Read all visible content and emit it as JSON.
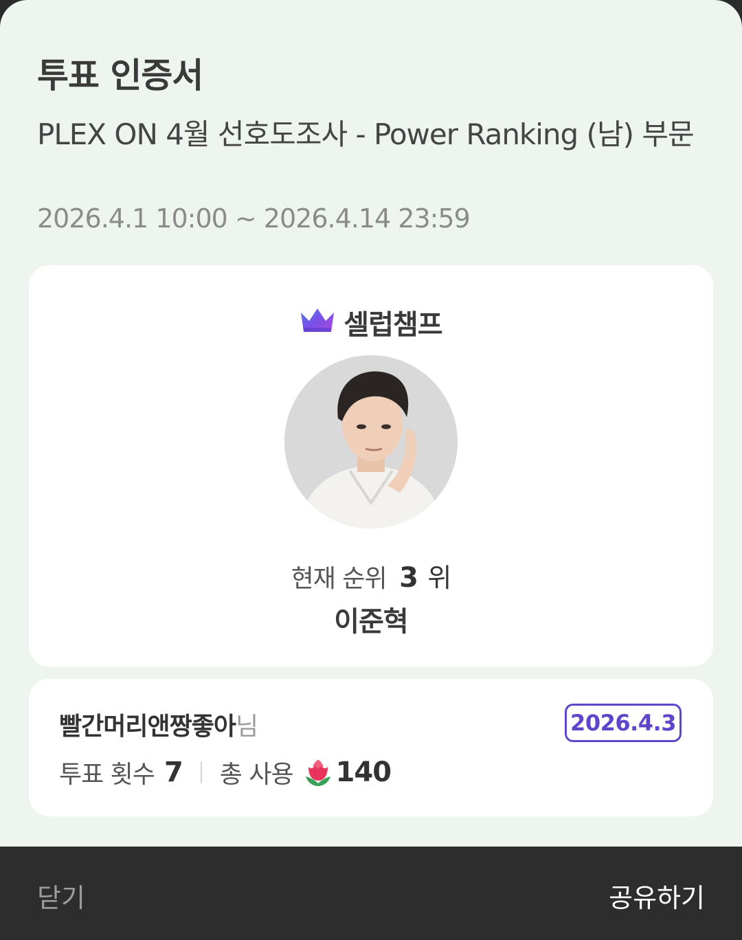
{
  "certificate": {
    "title": "투표 인증서",
    "subtitle": "PLEX ON 4월 선호도조사 - Power Ranking (남) 부문",
    "period": "2026.4.1 10:00 ~ 2026.4.14 23:59"
  },
  "brand": {
    "name": "셀럽챔프",
    "icon": "crown-icon",
    "accent": "#6a4fe0"
  },
  "celeb": {
    "rank_label": "현재 순위",
    "rank": "3",
    "rank_unit": "위",
    "name": "이준혁"
  },
  "voter": {
    "name": "빨간머리앤짱좋아",
    "suffix": "님",
    "date": "2026.4.3",
    "vote_count_label": "투표 횟수",
    "vote_count": "7",
    "total_used_label": "총 사용",
    "total_used_icon": "rose-icon",
    "total_used": "140"
  },
  "actions": {
    "close": "닫기",
    "share": "공유하기"
  }
}
